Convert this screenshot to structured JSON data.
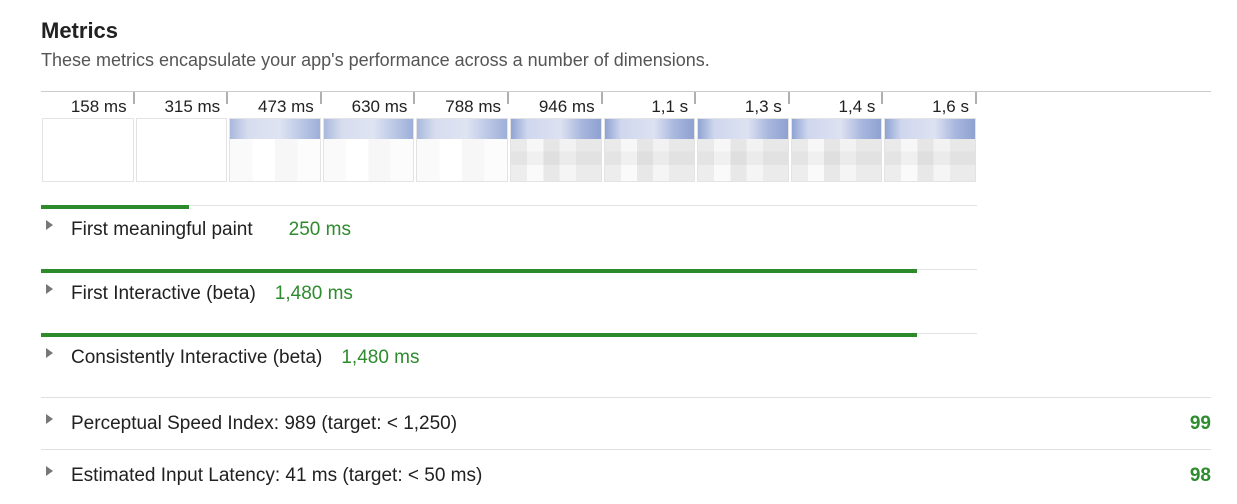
{
  "section": {
    "title": "Metrics",
    "subtitle": "These metrics encapsulate your app's performance across a number of dimensions."
  },
  "filmstrip": {
    "frames": [
      {
        "label": "158 ms",
        "state": "blank"
      },
      {
        "label": "315 ms",
        "state": "blank"
      },
      {
        "label": "473 ms",
        "state": "light"
      },
      {
        "label": "630 ms",
        "state": "light"
      },
      {
        "label": "788 ms",
        "state": "light"
      },
      {
        "label": "946 ms",
        "state": "loaded"
      },
      {
        "label": "1,1 s",
        "state": "loaded"
      },
      {
        "label": "1,3 s",
        "state": "loaded"
      },
      {
        "label": "1,4 s",
        "state": "loaded"
      },
      {
        "label": "1,6 s",
        "state": "loaded"
      }
    ]
  },
  "metrics": [
    {
      "label": "First meaningful paint",
      "value": "250 ms",
      "progress": 0.158
    },
    {
      "label": "First Interactive (beta)",
      "value": "1,480 ms",
      "progress": 0.936
    },
    {
      "label": "Consistently Interactive (beta)",
      "value": "1,480 ms",
      "progress": 0.936
    }
  ],
  "scored": [
    {
      "label": "Perceptual Speed Index: 989 (target: < 1,250)",
      "score": "99"
    },
    {
      "label": "Estimated Input Latency: 41 ms (target: < 50 ms)",
      "score": "98"
    }
  ],
  "colors": {
    "pass": "#2e8b2e",
    "bar": "#2c8c2c"
  },
  "icons": {
    "expand": "triangle-right-icon"
  }
}
